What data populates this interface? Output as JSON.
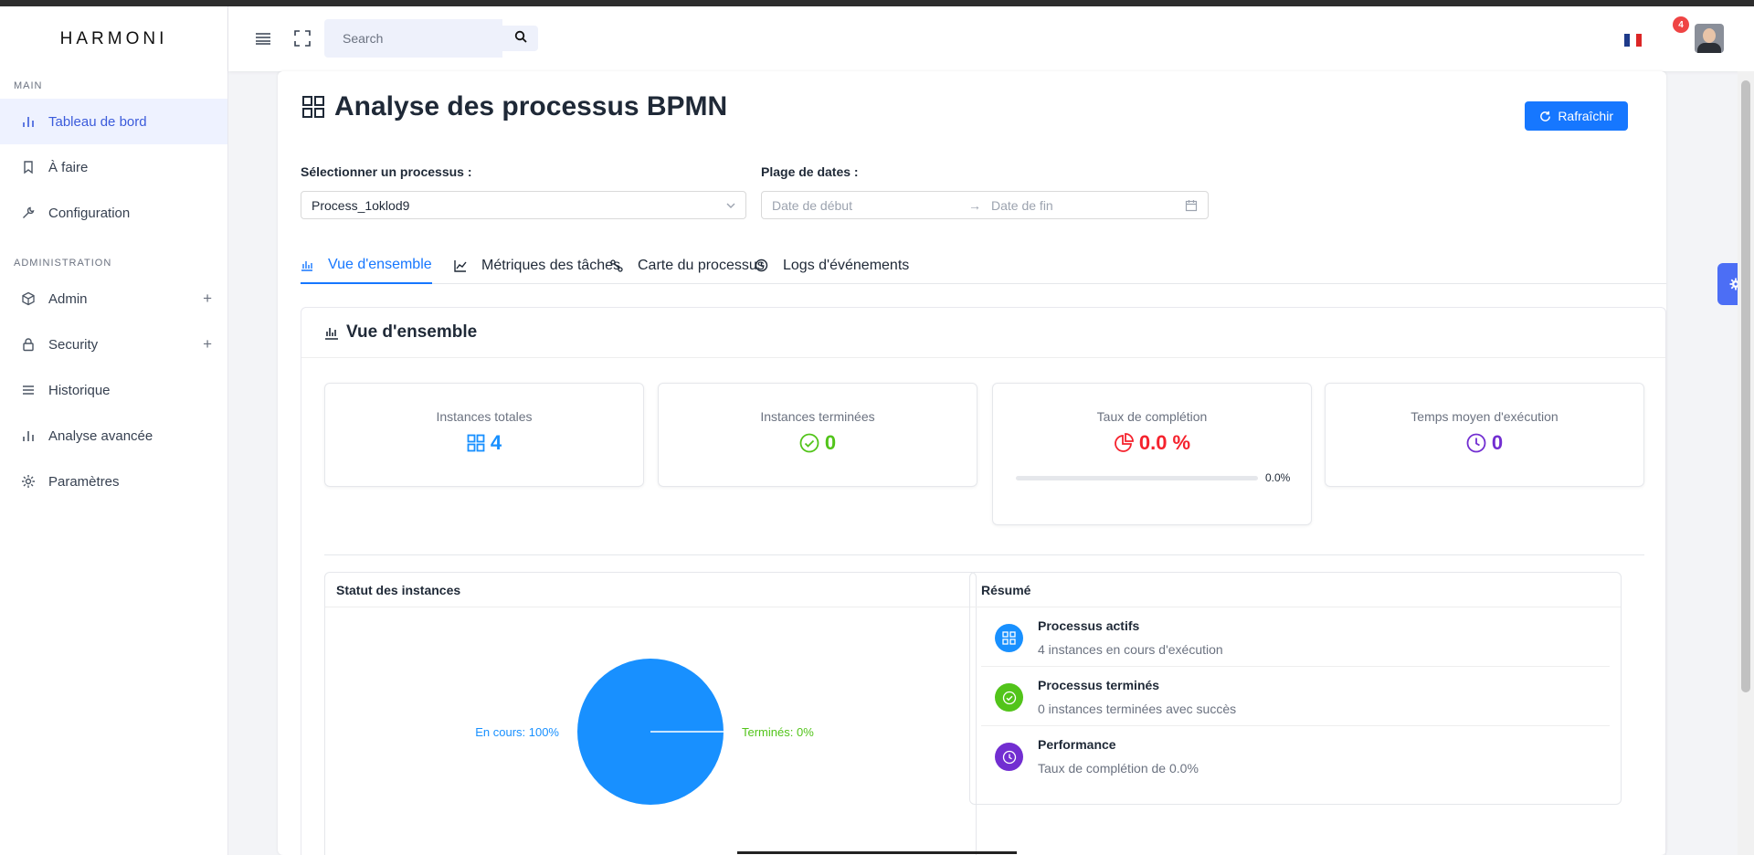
{
  "app": {
    "logo": "HARMONI"
  },
  "sidebar": {
    "sections": [
      {
        "title": "MAIN"
      },
      {
        "title": "ADMINISTRATION"
      }
    ],
    "items": [
      {
        "label": "Tableau de bord",
        "icon": "bar-chart-icon",
        "active": true
      },
      {
        "label": "À faire",
        "icon": "bookmark-icon"
      },
      {
        "label": "Configuration",
        "icon": "wrench-icon"
      },
      {
        "label": "Admin",
        "icon": "cube-icon",
        "expandable": true
      },
      {
        "label": "Security",
        "icon": "lock-icon",
        "expandable": true
      },
      {
        "label": "Historique",
        "icon": "list-icon"
      },
      {
        "label": "Analyse avancée",
        "icon": "bar-chart-icon"
      },
      {
        "label": "Paramètres",
        "icon": "gear-icon"
      }
    ],
    "expand_symbol": "+"
  },
  "topbar": {
    "search_placeholder": "Search",
    "notification_count": "4",
    "language": "FR"
  },
  "page": {
    "title": "Analyse des processus BPMN",
    "refresh_label": "Rafraîchir",
    "process_label": "Sélectionner un processus :",
    "process_value": "Process_1oklod9",
    "dates_label": "Plage de dates :",
    "date_start_placeholder": "Date de début",
    "date_end_placeholder": "Date de fin",
    "date_separator": "→"
  },
  "tabs": [
    {
      "label": "Vue d'ensemble",
      "active": true
    },
    {
      "label": "Métriques des tâches"
    },
    {
      "label": "Carte du processus"
    },
    {
      "label": "Logs d'événements"
    }
  ],
  "overview": {
    "title": "Vue d'ensemble",
    "stats": [
      {
        "title": "Instances totales",
        "value": "4",
        "color": "#1890ff"
      },
      {
        "title": "Instances terminées",
        "value": "0",
        "color": "#52c41a"
      },
      {
        "title": "Taux de complétion",
        "value": "0.0 %",
        "color": "#f5222d",
        "progress": 0.0,
        "progress_label": "0.0%"
      },
      {
        "title": "Temps moyen d'exécution",
        "value": "0",
        "color": "#722ed1"
      }
    ]
  },
  "status_panel": {
    "title": "Statut des instances",
    "chart_data": {
      "type": "pie",
      "slices": [
        {
          "label": "En cours: 100%",
          "value": 100,
          "color": "#1890ff"
        },
        {
          "label": "Terminés: 0%",
          "value": 0,
          "color": "#52c41a"
        }
      ]
    }
  },
  "summary": {
    "title": "Résumé",
    "items": [
      {
        "title": "Processus actifs",
        "desc": "4 instances en cours d'exécution",
        "color": "#1890ff",
        "icon": "grid-icon"
      },
      {
        "title": "Processus terminés",
        "desc": "0 instances terminées avec succès",
        "color": "#52c41a",
        "icon": "check-circle-icon"
      },
      {
        "title": "Performance",
        "desc": "Taux de complétion de 0.0%",
        "color": "#722ed1",
        "icon": "clock-icon"
      }
    ]
  },
  "colors": {
    "primary": "#1677ff",
    "active_nav": "#3b5bdb"
  }
}
